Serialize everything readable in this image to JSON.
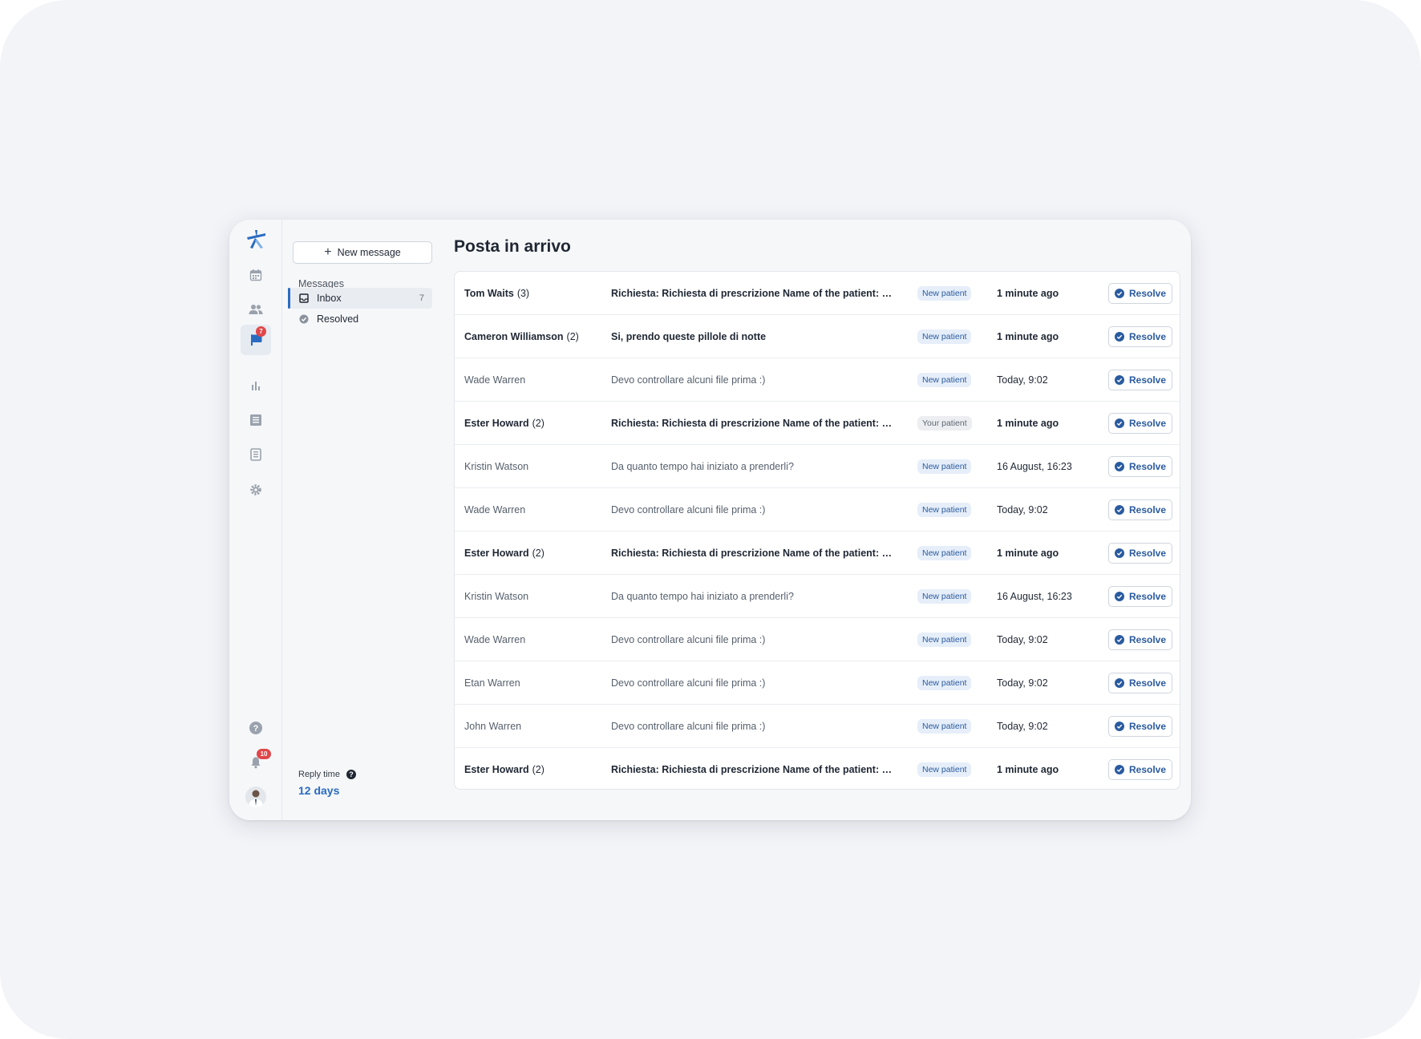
{
  "page": {
    "title": "Posta in arrivo"
  },
  "rail": {
    "items": [
      {
        "name": "calendar",
        "icon": "calendar-icon"
      },
      {
        "name": "patients",
        "icon": "people-icon"
      },
      {
        "name": "messages",
        "icon": "messages-icon",
        "badge": "7",
        "active": true
      },
      {
        "name": "statistics",
        "icon": "bar-chart-icon"
      },
      {
        "name": "documents",
        "icon": "document-icon"
      },
      {
        "name": "directory",
        "icon": "book-icon"
      },
      {
        "name": "settings",
        "icon": "gear-icon"
      }
    ],
    "bottom": [
      {
        "name": "help",
        "icon": "help-icon"
      },
      {
        "name": "notifications",
        "icon": "bell-icon",
        "badge": "10"
      },
      {
        "name": "profile",
        "icon": "avatar"
      }
    ]
  },
  "sidebar": {
    "new_message_label": "New message",
    "section_heading": "Messages",
    "items": [
      {
        "label": "Inbox",
        "count": "7",
        "active": true
      },
      {
        "label": "Resolved",
        "count": ""
      }
    ],
    "reply_time": {
      "label": "Reply time",
      "value": "12 days"
    }
  },
  "messages": [
    {
      "name": "Tom Waits",
      "count": "(3)",
      "subject": "Richiesta: Richiesta di prescrizione Name of the patient: Kathleen",
      "tag": "New patient",
      "tag_type": "new",
      "time": "1 minute ago",
      "unread": true,
      "action": "Resolve"
    },
    {
      "name": "Cameron Williamson",
      "count": "(2)",
      "subject": "Si, prendo queste pillole di notte",
      "tag": "New patient",
      "tag_type": "new",
      "time": "1 minute ago",
      "unread": true,
      "action": "Resolve"
    },
    {
      "name": "Wade Warren",
      "count": "",
      "subject": "Devo controllare alcuni file prima :)",
      "tag": "New patient",
      "tag_type": "new",
      "time": "Today, 9:02",
      "unread": false,
      "action": "Resolve"
    },
    {
      "name": "Ester Howard",
      "count": "(2)",
      "subject": "Richiesta: Richiesta di prescrizione Name of the patient: Kathleen",
      "tag": "Your patient",
      "tag_type": "your",
      "time": "1 minute ago",
      "unread": true,
      "action": "Resolve"
    },
    {
      "name": "Kristin Watson",
      "count": "",
      "subject": "Da quanto tempo hai iniziato a prenderli?",
      "tag": "New patient",
      "tag_type": "new",
      "time": "16 August, 16:23",
      "unread": false,
      "action": "Resolve"
    },
    {
      "name": "Wade Warren",
      "count": "",
      "subject": "Devo controllare alcuni file prima :)",
      "tag": "New patient",
      "tag_type": "new",
      "time": "Today, 9:02",
      "unread": false,
      "action": "Resolve"
    },
    {
      "name": "Ester Howard",
      "count": "(2)",
      "subject": "Richiesta: Richiesta di prescrizione Name of the patient: Kathleen",
      "tag": "New patient",
      "tag_type": "new",
      "time": "1 minute ago",
      "unread": true,
      "action": "Resolve"
    },
    {
      "name": "Kristin Watson",
      "count": "",
      "subject": "Da quanto tempo hai iniziato a prenderli?",
      "tag": "New patient",
      "tag_type": "new",
      "time": "16 August, 16:23",
      "unread": false,
      "action": "Resolve"
    },
    {
      "name": "Wade Warren",
      "count": "",
      "subject": "Devo controllare alcuni file prima :)",
      "tag": "New patient",
      "tag_type": "new",
      "time": "Today, 9:02",
      "unread": false,
      "action": "Resolve"
    },
    {
      "name": "Etan Warren",
      "count": "",
      "subject": "Devo controllare alcuni file prima :)",
      "tag": "New patient",
      "tag_type": "new",
      "time": "Today, 9:02",
      "unread": false,
      "action": "Resolve"
    },
    {
      "name": "John Warren",
      "count": "",
      "subject": "Devo controllare alcuni file prima :)",
      "tag": "New patient",
      "tag_type": "new",
      "time": "Today, 9:02",
      "unread": false,
      "action": "Resolve"
    },
    {
      "name": "Ester Howard",
      "count": "(2)",
      "subject": "Richiesta: Richiesta di prescrizione Name of the patient: Kathleen",
      "tag": "New patient",
      "tag_type": "new",
      "time": "1 minute ago",
      "unread": true,
      "action": "Resolve"
    }
  ],
  "colors": {
    "accent": "#2a6bc0",
    "badge": "#e0474a",
    "tag_new_bg": "#e6eef9",
    "tag_your_bg": "#eceef1"
  }
}
